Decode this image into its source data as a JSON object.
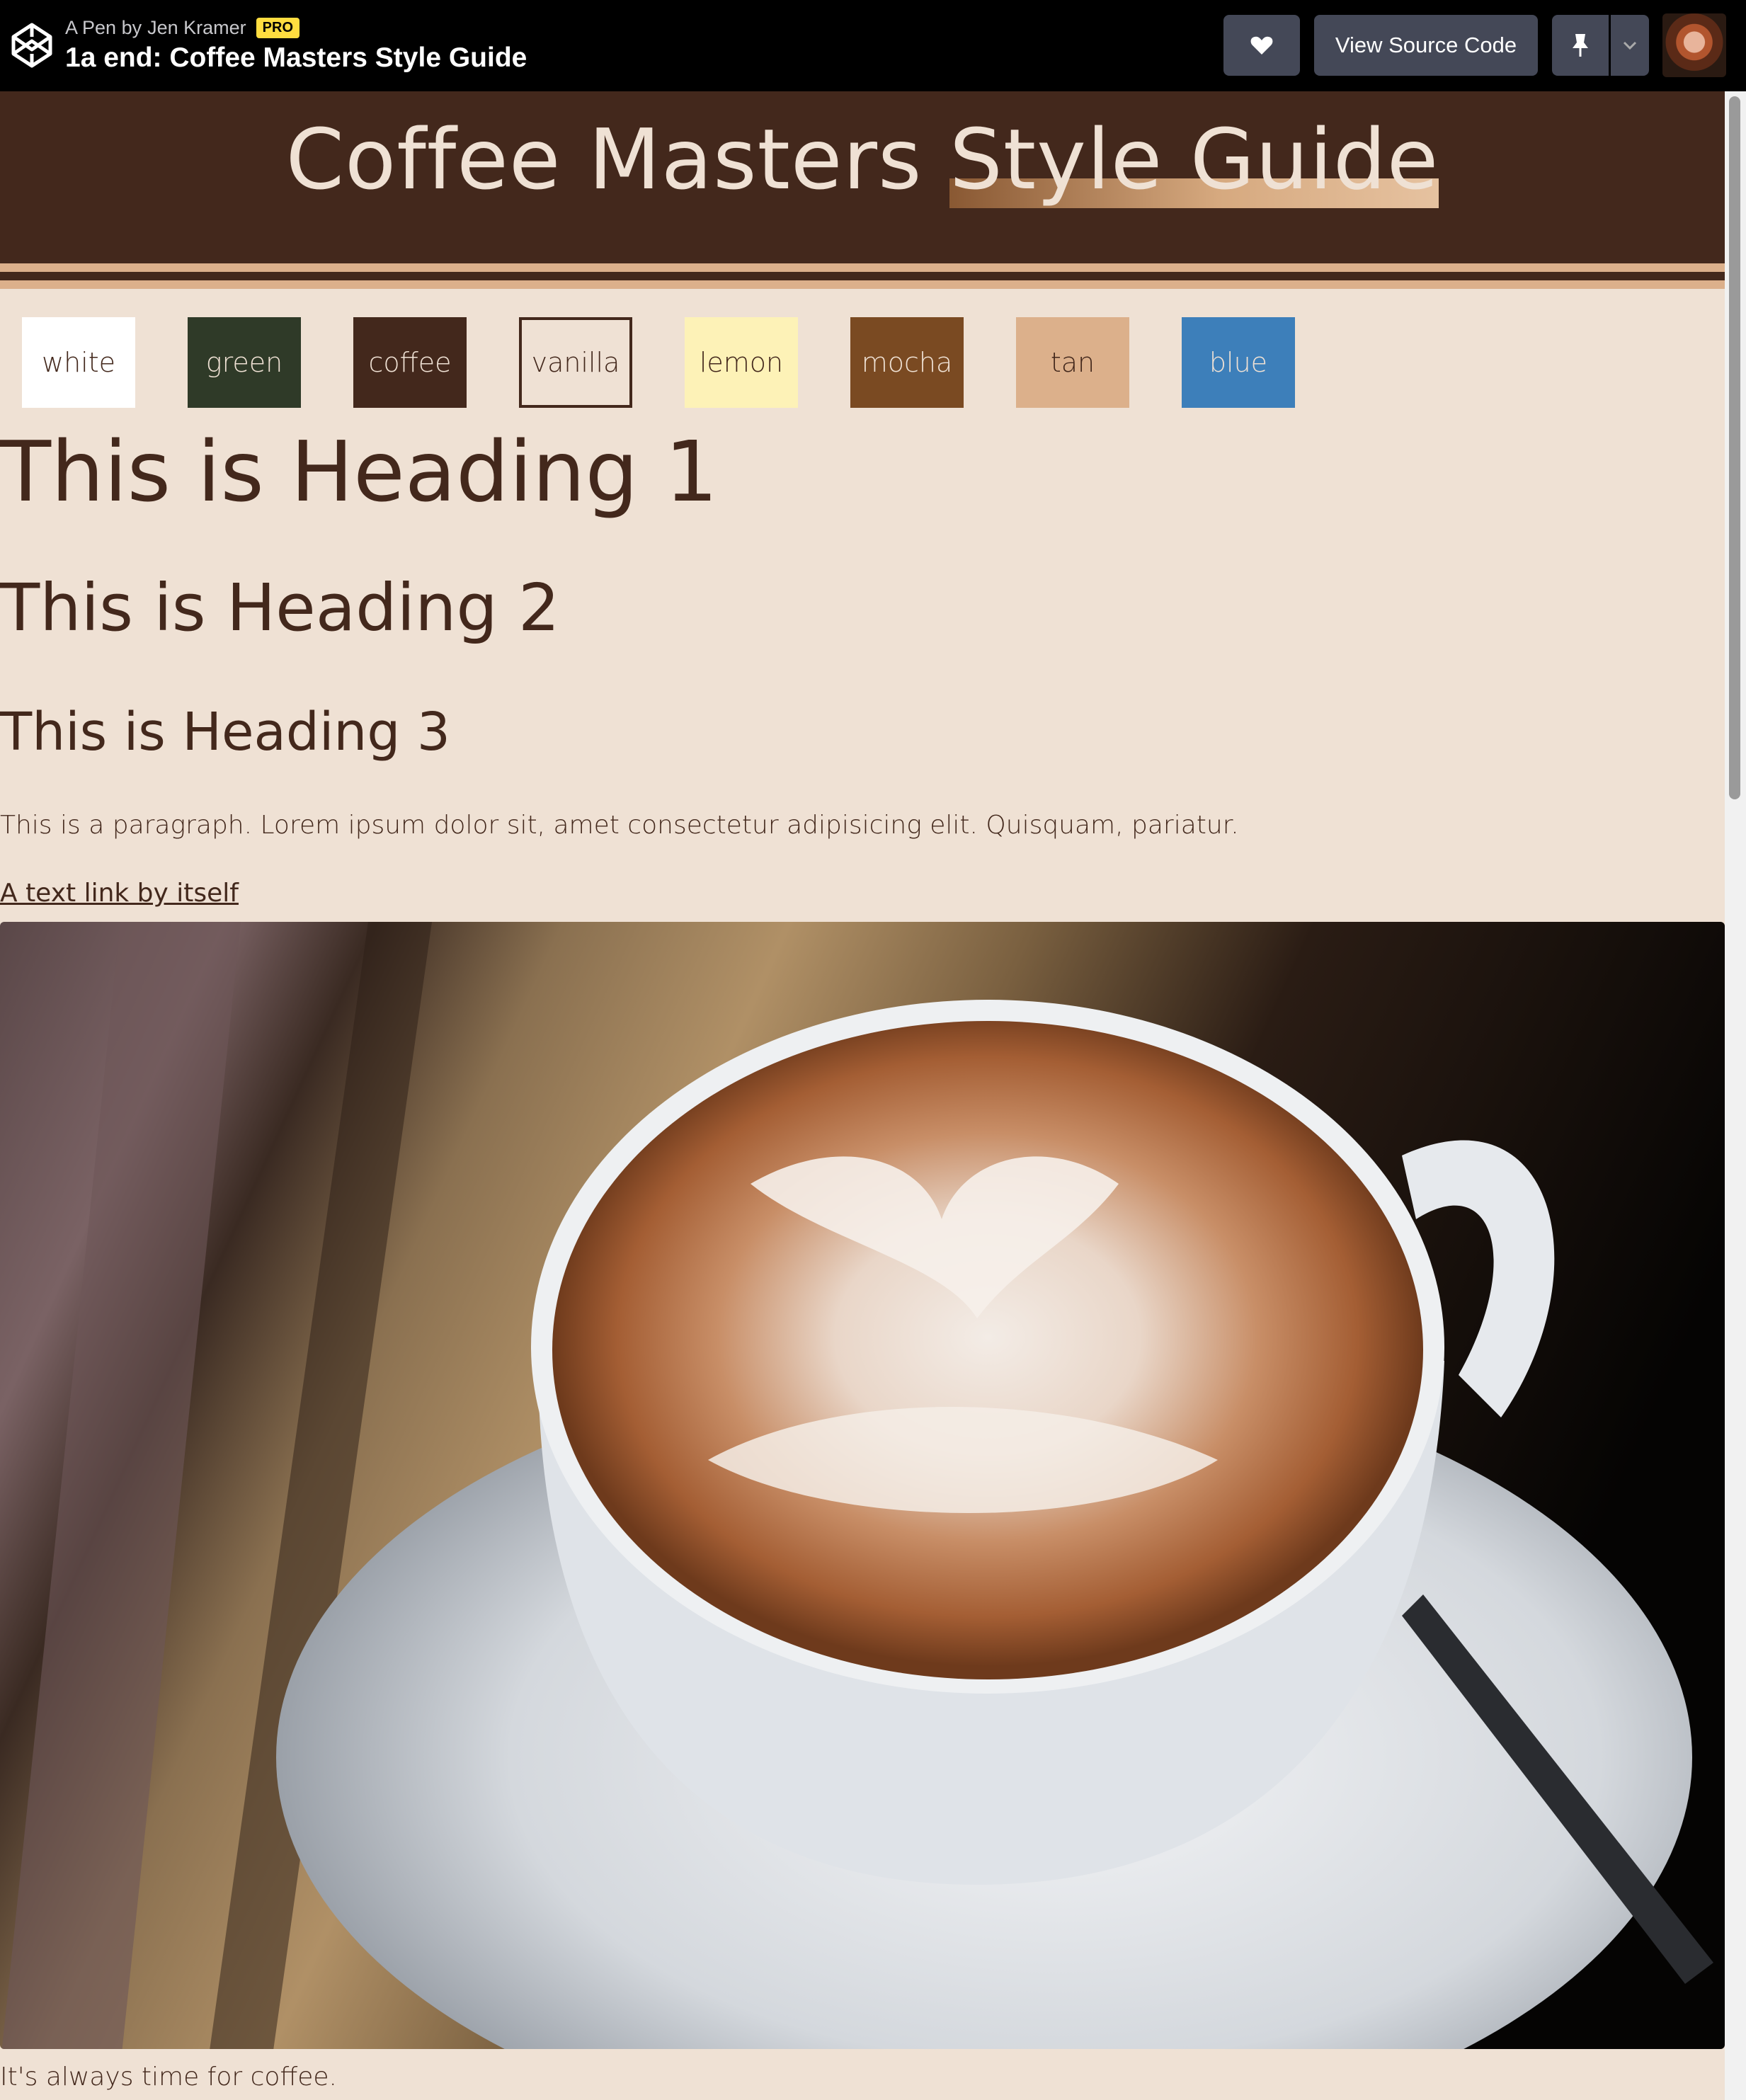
{
  "codepen": {
    "byline_prefix": "A Pen by",
    "author": "Jen Kramer",
    "pro_badge": "PRO",
    "pen_title": "1a end: Coffee Masters Style Guide",
    "view_source_label": "View Source Code"
  },
  "page": {
    "title_plain": "Coffee Masters",
    "title_highlight": "Style Guide",
    "swatches": [
      {
        "label": "white",
        "bg": "#ffffff",
        "fg": "#43281c"
      },
      {
        "label": "green",
        "bg": "#2f3a28",
        "fg": "#efe1d4"
      },
      {
        "label": "coffee",
        "bg": "#43281c",
        "fg": "#efe1d4"
      },
      {
        "label": "vanilla",
        "bg": "#efe1d4",
        "fg": "#43281c"
      },
      {
        "label": "lemon",
        "bg": "#fdf2b7",
        "fg": "#43281c"
      },
      {
        "label": "mocha",
        "bg": "#7a4a22",
        "fg": "#efe1d4"
      },
      {
        "label": "tan",
        "bg": "#dcb08b",
        "fg": "#43281c"
      },
      {
        "label": "blue",
        "bg": "#3d7fba",
        "fg": "#efe1d4"
      }
    ],
    "heading1": "This is Heading 1",
    "heading2": "This is Heading 2",
    "heading3": "This is Heading 3",
    "paragraph": "This is a paragraph. Lorem ipsum dolor sit, amet consectetur adipisicing elit. Quisquam, pariatur.",
    "link_text": "A text link by itself",
    "caption": "It's always time for coffee."
  },
  "colors": {
    "coffee": "#43281c",
    "vanilla": "#efe1d4",
    "tan": "#dcb08b"
  }
}
